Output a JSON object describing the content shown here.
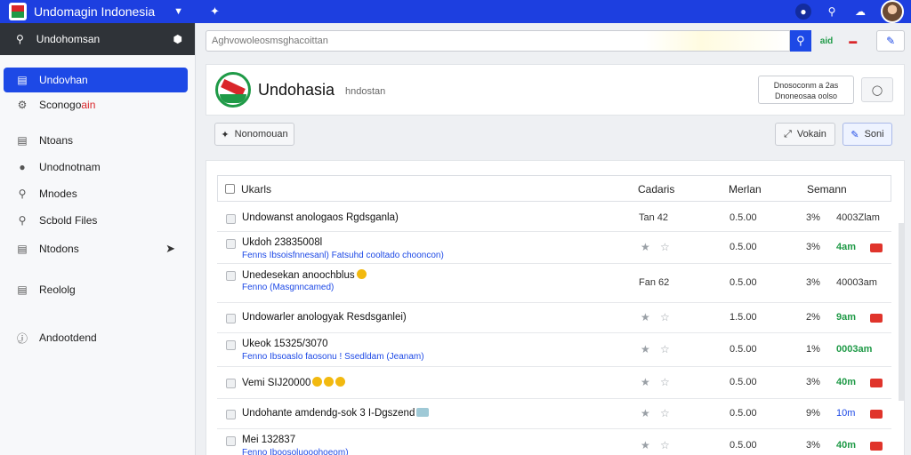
{
  "topbar": {
    "app_title": "Undomagin Indonesia",
    "icons": [
      "pin-icon",
      "shield-icon",
      "search-icon",
      "cloud-icon"
    ]
  },
  "sidebar": {
    "search_label": "Undohomsan",
    "items": [
      {
        "label": "Undovhan",
        "icon": "list-icon",
        "active": true
      },
      {
        "label": "Sconogo",
        "highlight": "ain",
        "icon": "gear-icon"
      },
      {
        "label": "Ntoans",
        "icon": "list-icon"
      },
      {
        "label": "Unodnotnam",
        "icon": "circle-icon"
      },
      {
        "label": "Mnodes",
        "icon": "key-icon"
      },
      {
        "label": "Scbold Files",
        "icon": "search-icon"
      },
      {
        "label": "Ntodons",
        "icon": "list-icon"
      },
      {
        "label": "Reololg",
        "icon": "list-icon"
      },
      {
        "label": "Andootdend",
        "icon": "info-icon"
      }
    ]
  },
  "search": {
    "placeholder": "Aghvowoleosmsghacoittan",
    "chip": "aid"
  },
  "org": {
    "name": "Undohasia",
    "subtitle": "hndostan",
    "action_line1": "Dnosoconm a 2as",
    "action_line2": "Dnoneosaa oolso"
  },
  "toolbar": {
    "left_button": "Nonomouan",
    "right_button_1": "Vokain",
    "right_button_2": "Soni"
  },
  "table": {
    "headers": {
      "title": "Ukarls",
      "cadaris": "Cadaris",
      "merlan": "Merlan",
      "semann": "Semann"
    },
    "rows": [
      {
        "title": "Undowanst anologaos Rgdsganla)",
        "sub": "",
        "cad": "Tan  42",
        "med": "0.5.00",
        "pct": "3%",
        "sem": "4003Zlam",
        "sem_style": "plain",
        "stars": false,
        "flag": false
      },
      {
        "title": "Ukdoh 23835008l",
        "sub": "Fenns Ibsoisfnnesanl) Fatsuhd cooltado chooncon)",
        "cad": "",
        "med": "0.5.00",
        "pct": "3%",
        "sem": "4am",
        "sem_style": "green",
        "stars": true,
        "flag": true
      },
      {
        "title": "Unedesekan anoochblus",
        "sub": "Fenno (Masgnncamed)",
        "cad": "Fan  62",
        "med": "0.5.00",
        "pct": "3%",
        "sem": "40003am",
        "sem_style": "plain",
        "stars": false,
        "flag": false,
        "emoji": true
      },
      {
        "title": "Undowarler anologyak Resdsganlei)",
        "sub": "",
        "cad": "",
        "med": "1.5.00",
        "pct": "2%",
        "sem": "9am",
        "sem_style": "green",
        "stars": true,
        "flag": true
      },
      {
        "title": "Ukeok 15325/3070",
        "sub": "Fenno Ibsoaslo faosonu ! Ssedldam (Jeanam)",
        "cad": "",
        "med": "0.5.00",
        "pct": "1%",
        "sem": "0003am",
        "sem_style": "green",
        "stars": true,
        "flag": false
      },
      {
        "title": "Vemi SIJ20000",
        "sub": "",
        "cad": "",
        "med": "0.5.00",
        "pct": "3%",
        "sem": "40m",
        "sem_style": "green",
        "stars": true,
        "flag": true,
        "emoji3": true
      },
      {
        "title": "Undohante amdendg-sok 3 I-Dgszend",
        "sub": "",
        "cad": "",
        "med": "0.5.00",
        "pct": "9%",
        "sem": "10m",
        "sem_style": "blue",
        "stars": true,
        "flag": true,
        "tag": true
      },
      {
        "title": "Mei 132837",
        "sub": "Fenno Iboosoluooohoeom)",
        "cad": "",
        "med": "0.5.00",
        "pct": "3%",
        "sem": "40m",
        "sem_style": "green",
        "stars": true,
        "flag": true
      }
    ]
  }
}
